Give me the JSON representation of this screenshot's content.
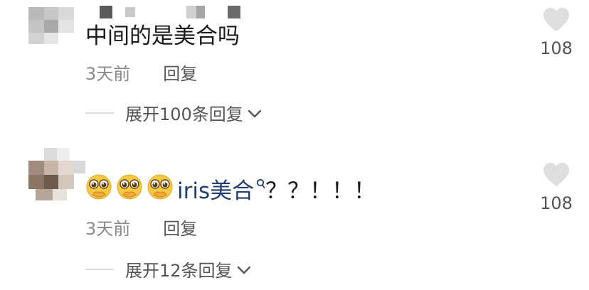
{
  "comments": [
    {
      "text": "中间的是美合吗",
      "time": "3天前",
      "reply_label": "回复",
      "expand_label": "展开100条回复",
      "likes": "108",
      "avatar_icon": "blurred-avatar",
      "like_icon": "heart-icon"
    },
    {
      "emojis": [
        "pleading-face-emoji",
        "pleading-face-emoji",
        "pleading-face-emoji"
      ],
      "mention": "iris美合",
      "text_after": "？？！！！",
      "time": "3天前",
      "reply_label": "回复",
      "expand_label": "展开12条回复",
      "likes": "108",
      "avatar_icon": "blurred-avatar",
      "like_icon": "heart-icon"
    }
  ],
  "colors": {
    "text": "#1a1a1a",
    "meta": "#8a8a8a",
    "mention": "#233d73",
    "heart": "#dedede"
  }
}
